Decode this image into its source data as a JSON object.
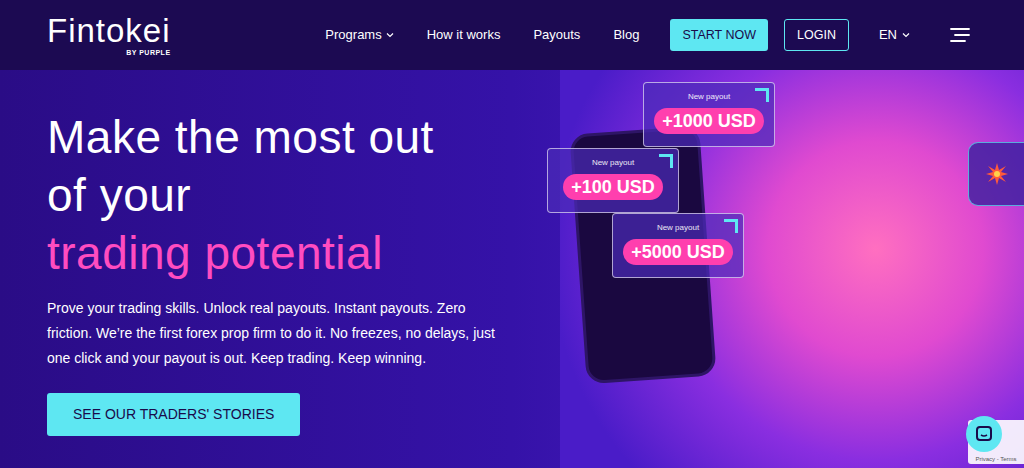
{
  "logo": {
    "name": "Fintokei",
    "tagline": "BY PURPLE"
  },
  "nav": [
    {
      "label": "Programs",
      "has_menu": true
    },
    {
      "label": "How it works",
      "has_menu": false
    },
    {
      "label": "Payouts",
      "has_menu": false
    },
    {
      "label": "Blog",
      "has_menu": false
    }
  ],
  "actions": {
    "start": "START NOW",
    "login": "LOGIN",
    "language": {
      "label": "EN",
      "has_menu": true
    }
  },
  "hero": {
    "title_lines": [
      "Make the most out",
      "of your"
    ],
    "highlight": "trading potential",
    "description": "Prove your trading skills. Unlock real payouts. Instant payouts. Zero friction. We’re the first forex prop firm to do it. No freezes, no delays, just one click and your payout is out. Keep trading. Keep winning.",
    "cta": "SEE OUR TRADERS' STORIES"
  },
  "payouts": [
    {
      "caption": "New payout",
      "amount": "+1000 USD"
    },
    {
      "caption": "New payout",
      "amount": "+100 USD"
    },
    {
      "caption": "New payout",
      "amount": "+5000 USD"
    }
  ],
  "recaptcha": "Privacy - Terms"
}
